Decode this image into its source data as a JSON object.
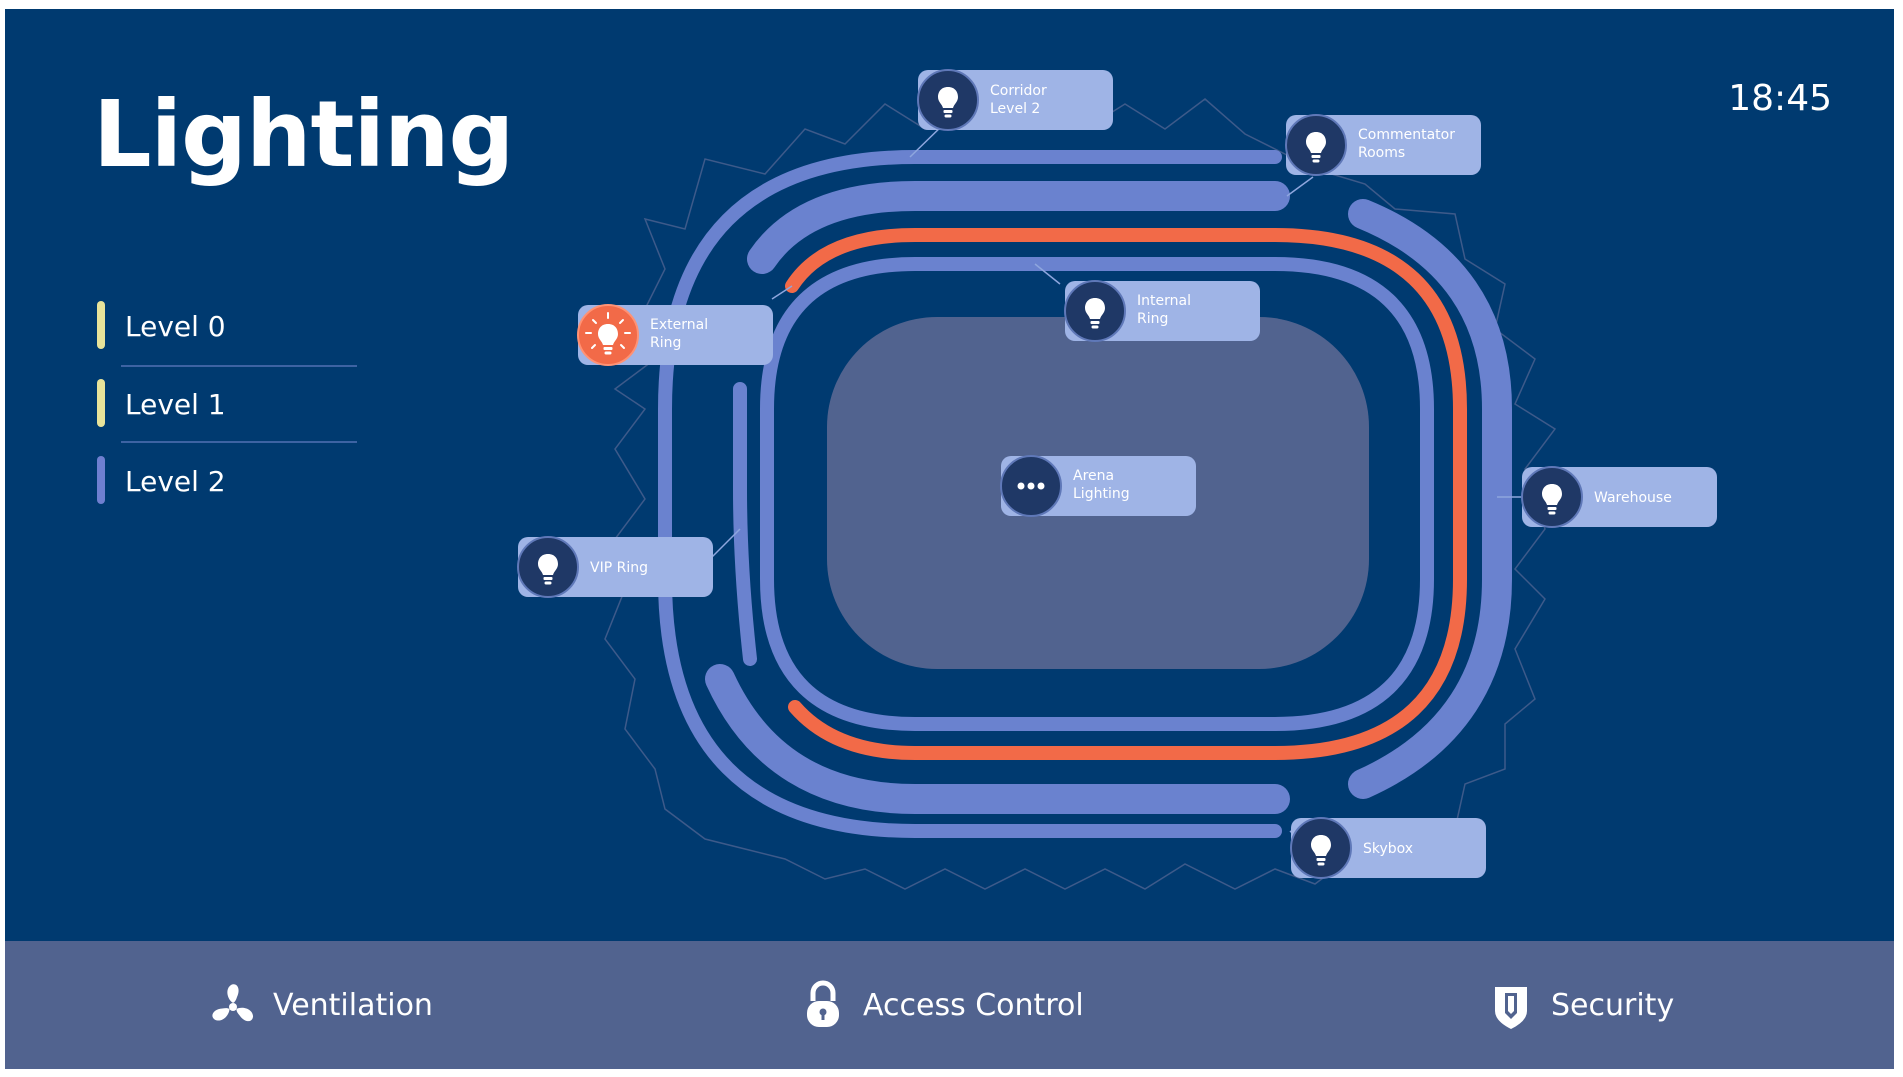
{
  "page": {
    "title": "Lighting",
    "clock": "18:45"
  },
  "levels": [
    {
      "label": "Level 0",
      "color": "#e8e39a"
    },
    {
      "label": "Level 1",
      "color": "#e8e39a"
    },
    {
      "label": "Level 2",
      "color": "#6f7fd0"
    }
  ],
  "zones": {
    "corridor": {
      "line1": "Corridor",
      "line2": "Level 2",
      "icon": "lightbulb-icon",
      "active": false
    },
    "commentator": {
      "line1": "Commentator",
      "line2": "Rooms",
      "icon": "lightbulb-icon",
      "active": false
    },
    "external": {
      "line1": "External",
      "line2": "Ring",
      "icon": "lightbulb-on-icon",
      "active": true
    },
    "internal": {
      "line1": "Internal",
      "line2": "Ring",
      "icon": "lightbulb-icon",
      "active": false
    },
    "arena": {
      "line1": "Arena",
      "line2": "Lighting",
      "icon": "more-icon",
      "active": false
    },
    "warehouse": {
      "line1": "Warehouse",
      "icon": "lightbulb-icon",
      "active": false
    },
    "vip": {
      "line1": "VIP Ring",
      "icon": "lightbulb-icon",
      "active": false
    },
    "skybox": {
      "line1": "Skybox",
      "icon": "lightbulb-icon",
      "active": false
    }
  },
  "colors": {
    "background": "#003a70",
    "ring": "#6a82cf",
    "active": "#f26a48",
    "field": "#51638f",
    "tag": "#9fb4e6",
    "icon_circle": "#1f3866",
    "nav_bar": "#51638f"
  },
  "nav": [
    {
      "label": "Ventilation",
      "icon": "fan-icon"
    },
    {
      "label": "Access Control",
      "icon": "lock-icon"
    },
    {
      "label": "Security",
      "icon": "shield-icon"
    }
  ]
}
